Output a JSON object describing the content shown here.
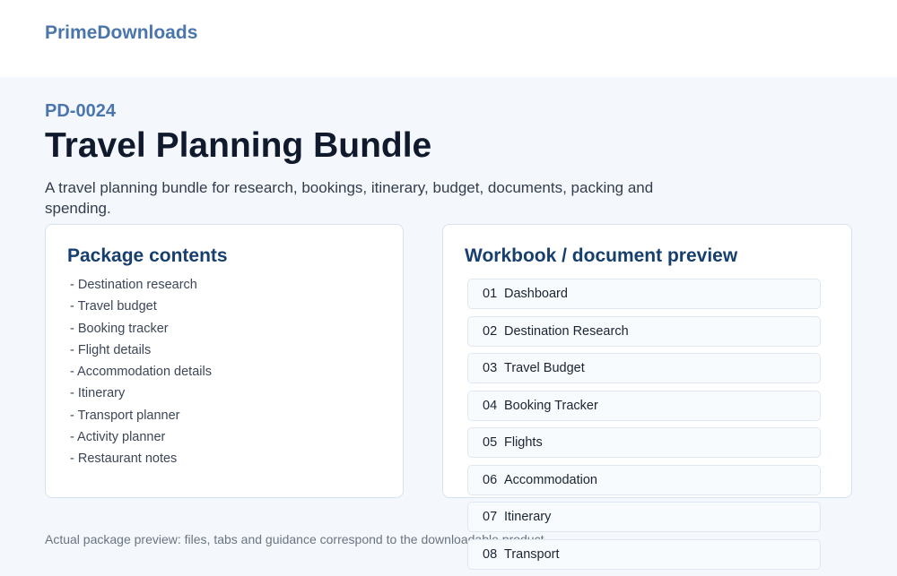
{
  "header": {
    "brand": "PrimeDownloads"
  },
  "product": {
    "code": "PD-0024",
    "title": "Travel Planning Bundle",
    "description": "A travel planning bundle for research, bookings, itinerary, budget, documents, packing and spending."
  },
  "package_contents": {
    "title": "Package contents",
    "items": [
      "- Destination research",
      "- Travel budget",
      "- Booking tracker",
      "- Flight details",
      "- Accommodation details",
      "- Itinerary",
      "- Transport planner",
      "- Activity planner",
      "- Restaurant notes"
    ]
  },
  "preview": {
    "title": "Workbook / document preview",
    "tabs": [
      {
        "num": "01",
        "label": "Dashboard"
      },
      {
        "num": "02",
        "label": "Destination Research"
      },
      {
        "num": "03",
        "label": "Travel Budget"
      },
      {
        "num": "04",
        "label": "Booking Tracker"
      },
      {
        "num": "05",
        "label": "Flights"
      },
      {
        "num": "06",
        "label": "Accommodation"
      },
      {
        "num": "07",
        "label": "Itinerary"
      },
      {
        "num": "08",
        "label": "Transport"
      }
    ]
  },
  "footnote": "Actual package preview: files, tabs and guidance correspond to the downloadable product."
}
